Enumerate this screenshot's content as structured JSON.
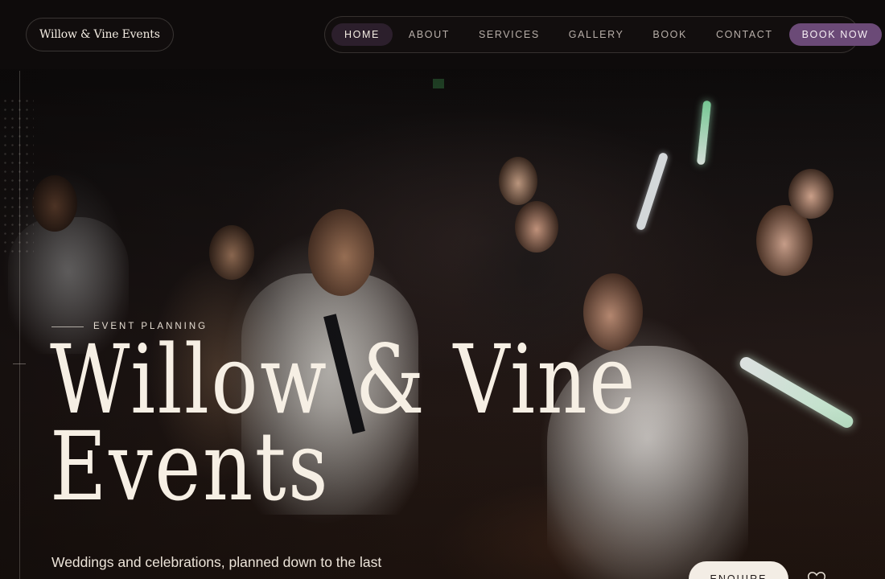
{
  "brand": {
    "name": "Willow & Vine Events"
  },
  "nav": {
    "items": [
      {
        "label": "HOME",
        "active": true
      },
      {
        "label": "ABOUT",
        "active": false
      },
      {
        "label": "SERVICES",
        "active": false
      },
      {
        "label": "GALLERY",
        "active": false
      },
      {
        "label": "BOOK",
        "active": false
      },
      {
        "label": "CONTACT",
        "active": false
      }
    ],
    "cta_label": "BOOK NOW"
  },
  "hero": {
    "eyebrow": "EVENT PLANNING",
    "title_line1": "Willow & Vine",
    "title_line2": "Events",
    "subtitle": "Weddings and celebrations, planned down to the last",
    "enquire_label": "ENQUIRE"
  },
  "icons": {
    "favorite": "heart-icon"
  },
  "colors": {
    "background": "#0e0b0b",
    "accent": "#6b4a77",
    "active_tab": "#2c1f2c",
    "text": "#f3ece2"
  }
}
